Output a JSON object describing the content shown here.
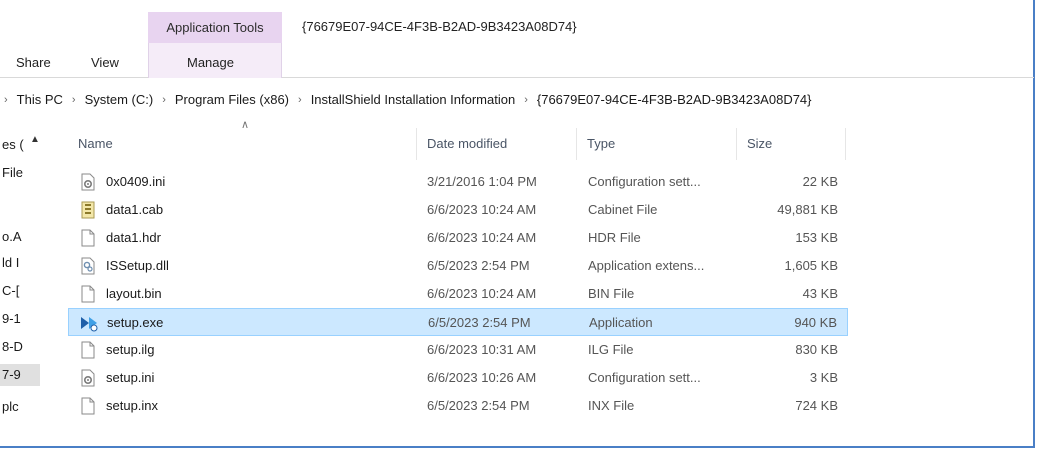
{
  "ribbon": {
    "context_tab": "Application Tools",
    "window_title": "{76679E07-94CE-4F3B-B2AD-9B3423A08D74}",
    "tabs": [
      "Share",
      "View",
      "Manage"
    ]
  },
  "address": {
    "crumbs": [
      "This PC",
      "System (C:)",
      "Program Files (x86)",
      "InstallShield Installation Information",
      "{76679E07-94CE-4F3B-B2AD-9B3423A08D74}"
    ]
  },
  "navpane": {
    "items": [
      "es (",
      "File",
      "",
      "o.A",
      "ld I",
      "C-[",
      "9-1",
      "8-D",
      "7-9",
      "plc"
    ]
  },
  "columns": {
    "name": "Name",
    "date": "Date modified",
    "type": "Type",
    "size": "Size"
  },
  "files": [
    {
      "name": "0x0409.ini",
      "date": "3/21/2016 1:04 PM",
      "type": "Configuration sett...",
      "size": "22 KB",
      "icon": "ini-file-icon"
    },
    {
      "name": "data1.cab",
      "date": "6/6/2023 10:24 AM",
      "type": "Cabinet File",
      "size": "49,881 KB",
      "icon": "cab-file-icon"
    },
    {
      "name": "data1.hdr",
      "date": "6/6/2023 10:24 AM",
      "type": "HDR File",
      "size": "153 KB",
      "icon": "blank-file-icon"
    },
    {
      "name": "ISSetup.dll",
      "date": "6/5/2023 2:54 PM",
      "type": "Application extens...",
      "size": "1,605 KB",
      "icon": "dll-file-icon"
    },
    {
      "name": "layout.bin",
      "date": "6/6/2023 10:24 AM",
      "type": "BIN File",
      "size": "43 KB",
      "icon": "blank-file-icon"
    },
    {
      "name": "setup.exe",
      "date": "6/5/2023 2:54 PM",
      "type": "Application",
      "size": "940 KB",
      "icon": "installer-app-icon",
      "selected": true
    },
    {
      "name": "setup.ilg",
      "date": "6/6/2023 10:31 AM",
      "type": "ILG File",
      "size": "830 KB",
      "icon": "blank-file-icon"
    },
    {
      "name": "setup.ini",
      "date": "6/6/2023 10:26 AM",
      "type": "Configuration sett...",
      "size": "3 KB",
      "icon": "ini-file-icon"
    },
    {
      "name": "setup.inx",
      "date": "6/5/2023 2:54 PM",
      "type": "INX File",
      "size": "724 KB",
      "icon": "blank-file-icon"
    }
  ],
  "colors": {
    "selection_bg": "#cce8ff",
    "selection_border": "#99d1ff",
    "context_tab": "#e8d4f0",
    "frame_border": "#4a7fc6"
  }
}
